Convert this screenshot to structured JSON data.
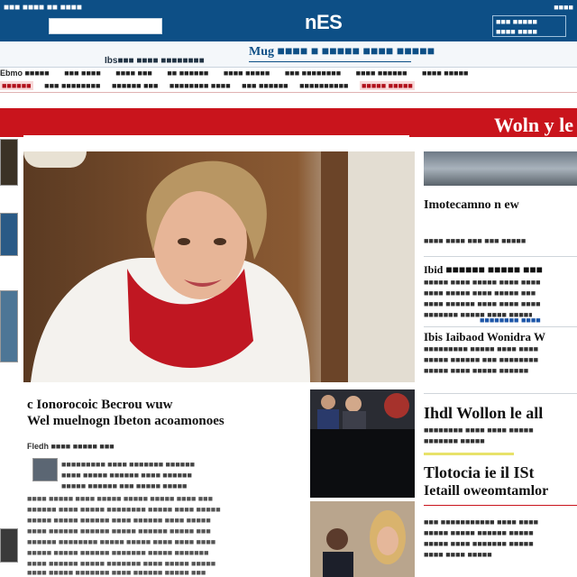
{
  "header": {
    "left_label": "■■■ ■■■■ ■■ ■■■■",
    "brand": "nES",
    "right_top": "■■■■",
    "right_box": "■■■ ■■■■■\n■■■■ ■■■■"
  },
  "subnav": {
    "left_label": "Ibs■■■ ■■■■ ■■■■■■■■",
    "tagline": "Mug ■■■■ ■ ■■■■■ ■■■■ ■■■■■"
  },
  "nav": {
    "row1": [
      "Ebmo ■■■■■",
      "■■■ ■■■■",
      "■■■■ ■■■",
      "■■ ■■■■■■",
      "■■■■ ■■■■■",
      "■■■ ■■■■■■■■",
      "■■■■ ■■■■■■",
      "■■■■ ■■■■■"
    ],
    "row2": [
      "■■■■■■",
      "■■■ ■■■■■■■■",
      "■■■■■■ ■■■",
      "■■■■■■■■ ■■■■",
      "■■■ ■■■■■■",
      "■■■■■■■■■■",
      "■■■■■ ■■■■■"
    ]
  },
  "banner": {
    "title": "Woln y le"
  },
  "right": {
    "story1_title": "Imotecamno n ew",
    "story1_line": "■■■■ ■■■■ ■■■ ■■■ ■■■■■",
    "story2_title": "Ibid ■■■■■■ ■■■■■ ■■■",
    "story2_lines": [
      "■■■■■ ■■■■ ■■■■■ ■■■■ ■■■■",
      "■■■■ ■■■■■ ■■■■ ■■■■■ ■■■",
      "■■■■ ■■■■■■ ■■■■ ■■■■ ■■■■",
      "■■■■■■■ ■■■■■ ■■■■ ■■■■■"
    ],
    "story2_link": "■■■■■■■■ ■■■■",
    "story3_title": "Ibis Iaibaod Wonidra W",
    "story3_lines": [
      "■■■■■■■■■ ■■■■■ ■■■■ ■■■■",
      "■■■■■ ■■■■■■ ■■■ ■■■■■■■■",
      "■■■■■ ■■■■ ■■■■■ ■■■■■■"
    ],
    "story4_title": "Ihdl Wollon le all",
    "story4_lines": [
      "■■■■■■■■ ■■■■ ■■■■ ■■■■■",
      "■■■■■■■ ■■■■■"
    ],
    "story5_title": "Tlotocia ie il ISt",
    "story5_subtitle": "Ietaill oweomtamlor",
    "story5_lines": [
      "■■■ ■■■■■■■■■■■ ■■■■ ■■■■",
      "■■■■■ ■■■■■ ■■■■■■ ■■■■■",
      "■■■■■ ■■■■ ■■■■■■■ ■■■■■",
      "■■■■ ■■■■ ■■■■■"
    ]
  },
  "article": {
    "headline_1": "c Ionorocoic Becrou wuw",
    "headline_2": "Wel muelnogn Ibeton acoamonoes",
    "byline": "Fledh ■■■■ ■■■■■ ■■■",
    "intro_lines": [
      "■■■■■■■■■ ■■■■ ■■■■■■■ ■■■■■■",
      "■■■■ ■■■■■ ■■■■■■ ■■■■ ■■■■■■",
      "■■■■■ ■■■■■■ ■■■ ■■■■■ ■■■■■"
    ],
    "body_lines": [
      "■■■■ ■■■■■ ■■■■ ■■■■■ ■■■■■ ■■■■■ ■■■■ ■■■",
      "■■■■■■ ■■■■ ■■■■■ ■■■■■■■■ ■■■■■ ■■■■ ■■■■■",
      "■■■■■ ■■■■■ ■■■■■■ ■■■■ ■■■■■■ ■■■■ ■■■■■",
      "■■■■ ■■■■■■ ■■■■■■ ■■■■■ ■■■■■■ ■■■■■ ■■■",
      "■■■■■■ ■■■■■■■■ ■■■■■ ■■■■■ ■■■■ ■■■■ ■■■■",
      "■■■■■ ■■■■■ ■■■■■■ ■■■■■■■ ■■■■■ ■■■■■■■",
      "■■■■ ■■■■■■ ■■■■■ ■■■■■■■ ■■■■ ■■■■■ ■■■■■",
      "■■■■ ■■■■■ ■■■■■■■ ■■■■ ■■■■■■ ■■■■■ ■■■"
    ]
  },
  "colors": {
    "header_bg": "#0d4f86",
    "accent_red": "#c9141c",
    "link": "#1d56a8"
  }
}
